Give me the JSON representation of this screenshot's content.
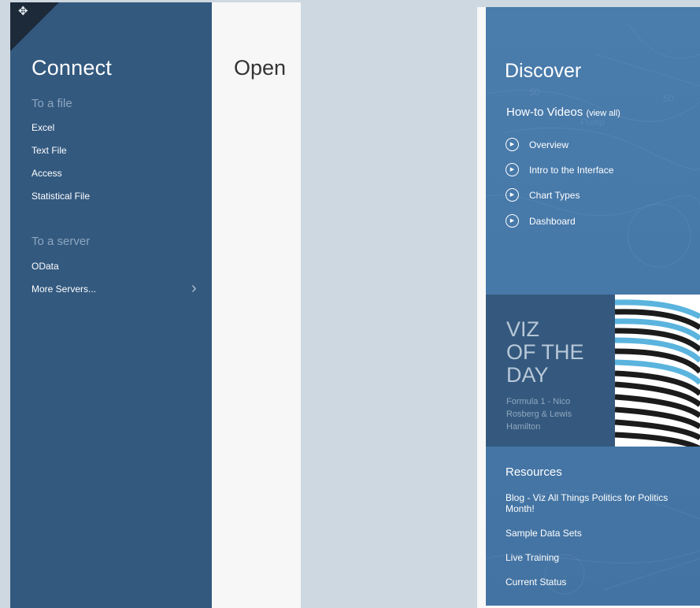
{
  "connect": {
    "title": "Connect",
    "file_section": "To a file",
    "file_items": [
      "Excel",
      "Text File",
      "Access",
      "Statistical File"
    ],
    "server_section": "To a server",
    "server_items": [
      "OData",
      "More Servers..."
    ],
    "icons": {
      "move": "move-arrows-icon",
      "more": "chevron-right-icon"
    }
  },
  "open": {
    "title": "Open"
  },
  "discover": {
    "title": "Discover",
    "videos_heading": "How-to Videos",
    "view_all": "(view all)",
    "videos": [
      "Overview",
      "Intro to the Interface",
      "Chart Types",
      "Dashboard"
    ],
    "play_icon": "play-circle-icon",
    "viz_of_the_day": {
      "title": "VIZ\nOF THE\nDAY",
      "subtitle": "Formula 1 - Nico Rosberg & Lewis Hamilton"
    },
    "resources_heading": "Resources",
    "resources": [
      "Blog - Viz All Things Politics for Politics Month!",
      "Sample Data Sets",
      "Live Training",
      "Current Status"
    ]
  },
  "colors": {
    "connect_bg": "#33597f",
    "open_bg": "#f7f7f7",
    "discover_bg": "#4678a8",
    "votd_bg": "#35597e",
    "section_muted": "#8ea6bf"
  }
}
